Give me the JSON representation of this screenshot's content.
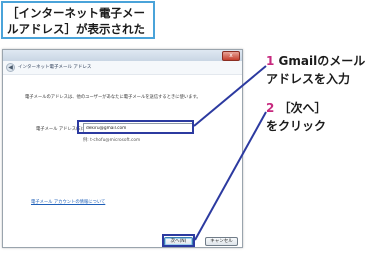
{
  "caption": {
    "line1": "［インターネット電子メー",
    "line2": "ルアドレス］が表示された"
  },
  "dialog": {
    "close_label": "x",
    "back_icon": "back-arrow-icon",
    "wizard_title": "インターネット電子メール アドレス",
    "description": "電子メールのアドレスは、他のユーザーがあなたに電子メールを送信するときに使います。",
    "email_label": "電子メール アドレス(E):",
    "email_value": "dekiru@gmail.com",
    "example_text": "例: t-chofu@microsoft.com",
    "info_link": "電子メール アカウントの情報について",
    "next_button": "次へ(N)",
    "cancel_button": "キャンセル"
  },
  "callouts": [
    {
      "number": "1",
      "line1": "Gmailのメール",
      "line2": "アドレスを入力"
    },
    {
      "number": "2",
      "line1": "［次へ］",
      "line2": "をクリック"
    }
  ],
  "colors": {
    "caption_border": "#4aa3d9",
    "callout_number": "#c7287e",
    "highlight": "#2c3aa0"
  }
}
